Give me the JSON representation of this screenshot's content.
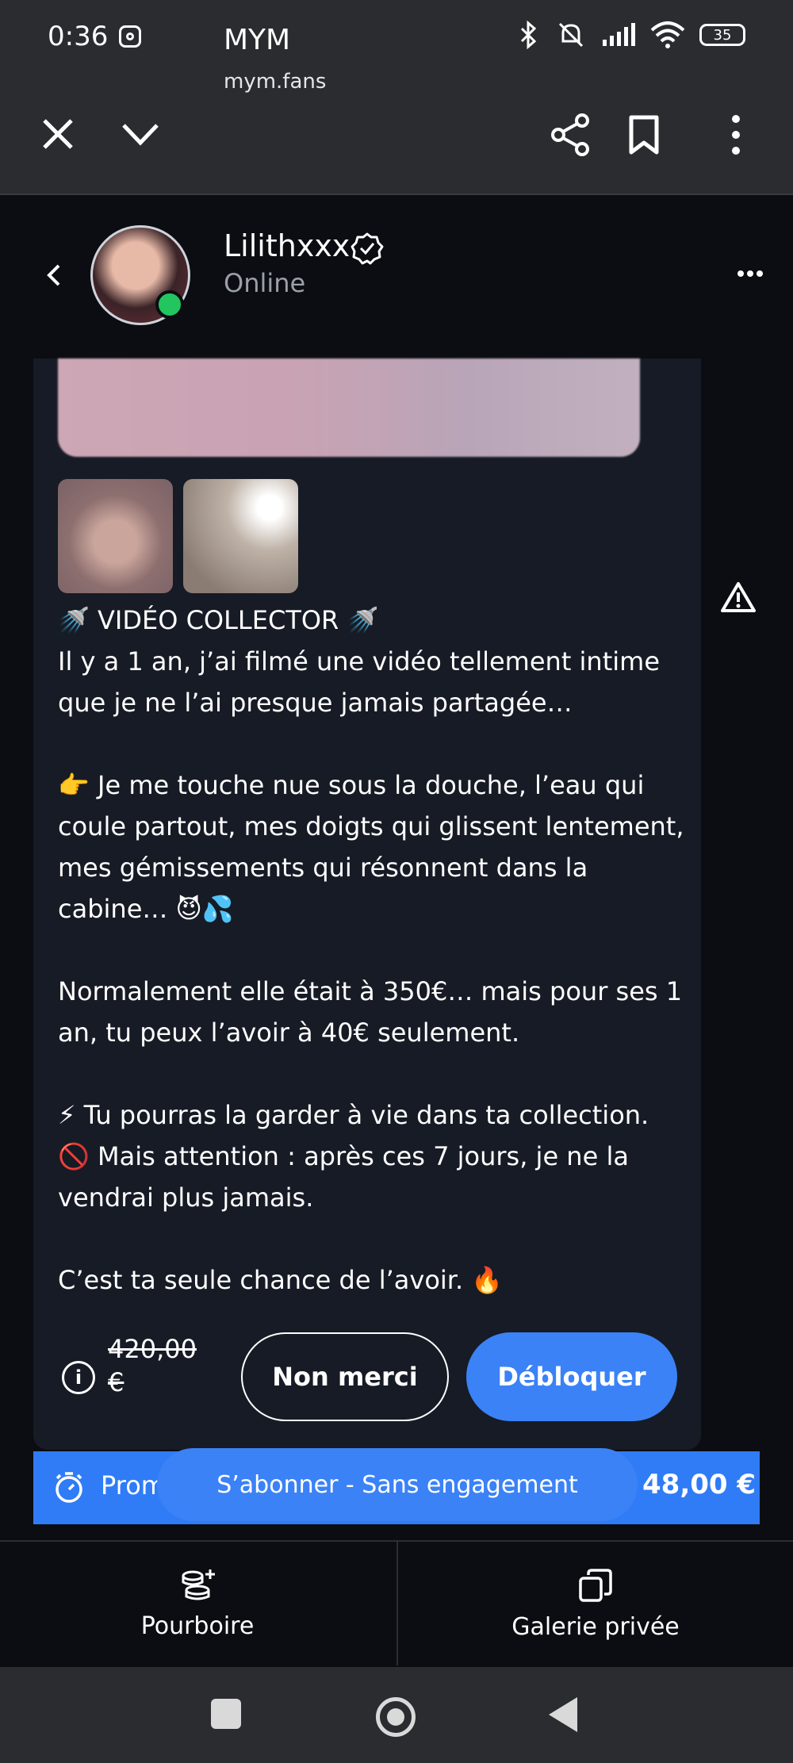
{
  "status_bar": {
    "time": "0:36",
    "battery": "35"
  },
  "browser": {
    "title": "MYM",
    "url": "mym.fans"
  },
  "chat": {
    "username": "Lilithxxx",
    "status": "Online"
  },
  "message": {
    "text": "🚿 VIDÉO COLLECTOR 🚿\nIl y a 1 an, j’ai filmé une vidéo tellement intime que je ne l’ai presque jamais partagée…\n\n👉 Je me touche nue sous la douche, l’eau qui coule partout, mes doigts qui glissent lentement, mes gémissements qui résonnent dans la cabine… 😈💦\n\nNormalement elle était à 350€… mais pour ses 1 an, tu peux l’avoir à 40€ seulement.\n\n⚡ Tu pourras la garder à vie dans ta collection.\n🚫 Mais attention : après ces 7 jours, je ne la vendrai plus jamais.\n\nC’est ta seule chance de l’avoir. 🔥",
    "old_price": "420,00 €",
    "decline_label": "Non merci",
    "unlock_label": "Débloquer"
  },
  "promo": {
    "text": "Prom",
    "price": "48,00 €",
    "subscribe_label": "S’abonner - Sans engagement"
  },
  "tabs": [
    {
      "label": "Pourboire",
      "icon": "coins-plus-icon"
    },
    {
      "label": "Galerie privée",
      "icon": "copy-gallery-icon"
    }
  ],
  "colors": {
    "accent": "#3b82f6",
    "online": "#22c55e",
    "card": "#161b25",
    "background": "#0b0d12"
  }
}
